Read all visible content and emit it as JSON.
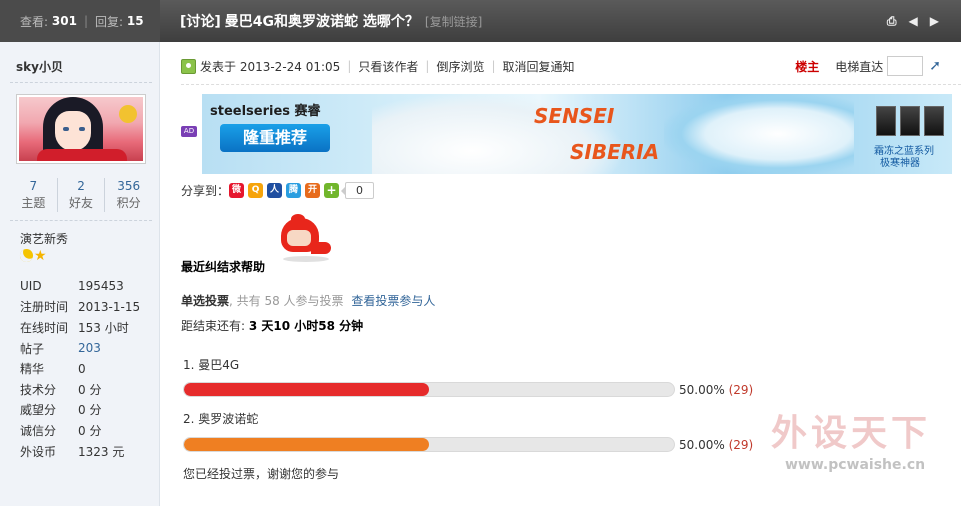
{
  "topbar": {
    "views_label": "查看:",
    "views": "301",
    "replies_label": "回复:",
    "replies": "15",
    "thread_type": "[讨论]",
    "title": "曼巴4G和奥罗波诺蛇 选哪个？",
    "copy_link": "[复制链接]",
    "tools": {
      "print_icon": "print-icon",
      "prev_icon": "arrow-left-icon",
      "next_icon": "arrow-right-icon"
    }
  },
  "author": {
    "name": "sky小贝",
    "counts": [
      {
        "value": "7",
        "label": "主题"
      },
      {
        "value": "2",
        "label": "好友"
      },
      {
        "value": "356",
        "label": "积分"
      }
    ],
    "rank": "演艺新秀",
    "info": [
      {
        "key": "UID",
        "value": "195453",
        "link": false
      },
      {
        "key": "注册时间",
        "value": "2013-1-15",
        "link": false
      },
      {
        "key": "在线时间",
        "value": "153 小时",
        "link": false
      },
      {
        "key": "帖子",
        "value": "203",
        "link": true
      },
      {
        "key": "精华",
        "value": "0",
        "link": false
      },
      {
        "key": "技术分",
        "value": "0 分",
        "link": false
      },
      {
        "key": "威望分",
        "value": "0 分",
        "link": false
      },
      {
        "key": "诚信分",
        "value": "0 分",
        "link": false
      },
      {
        "key": "外设币",
        "value": "1323 元",
        "link": false
      }
    ]
  },
  "postbar": {
    "posted": "发表于 2013-2-24 01:05",
    "only_author": "只看该作者",
    "reverse": "倒序浏览",
    "cancel_notify": "取消回复通知",
    "louzhu": "楼主",
    "elevator": "电梯直达"
  },
  "banner": {
    "ad_badge": "AD",
    "brand": "steelseries 赛睿",
    "promo": "隆重推荐",
    "product1": "SENSEI",
    "product2": "SIBERIA",
    "caption1": "霜冻之蓝系列",
    "caption2": "极寒神器"
  },
  "share": {
    "label": "分享到：",
    "count": "0"
  },
  "post": {
    "text": "最近纠结求帮助"
  },
  "vote": {
    "kind": "单选投票",
    "meta": ", 共有 58 人参与投票",
    "view_voters": "查看投票参与人",
    "end_label": "距结束还有:",
    "end_time": "3 天10 小时58 分钟",
    "options": [
      {
        "label": "1.  曼巴4G",
        "percent": "50.00%",
        "count": "(29)",
        "fraction": 0.5,
        "color": "#e62b2b"
      },
      {
        "label": "2.  奥罗波诺蛇",
        "percent": "50.00%",
        "count": "(29)",
        "fraction": 0.5,
        "color": "#ef7f22"
      }
    ],
    "voted_msg": "您已经投过票，谢谢您的参与"
  },
  "watermark": {
    "text": "外设天下",
    "url": "www.pcwaishe.cn"
  }
}
